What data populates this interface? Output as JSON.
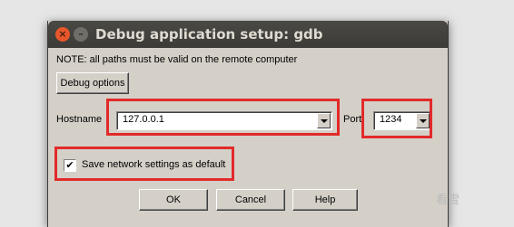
{
  "window": {
    "title": "Debug application setup: gdb",
    "close_glyph": "×",
    "minimize_glyph": "–"
  },
  "note": "NOTE: all paths must be valid on the remote computer",
  "buttons": {
    "debug_options": "Debug options",
    "ok": "OK",
    "cancel": "Cancel",
    "help": "Help"
  },
  "hostname": {
    "label": "Hostname",
    "value": "127.0.0.1"
  },
  "port": {
    "label": "Port",
    "value": "1234"
  },
  "save_settings": {
    "label": "Save network settings as default",
    "checked": true,
    "check_glyph": "✔"
  },
  "colors": {
    "highlight": "#e22a2a",
    "dialog_bg": "#d4d0c8",
    "titlebar_bg": "#3c3b37"
  },
  "watermark": "看雪"
}
